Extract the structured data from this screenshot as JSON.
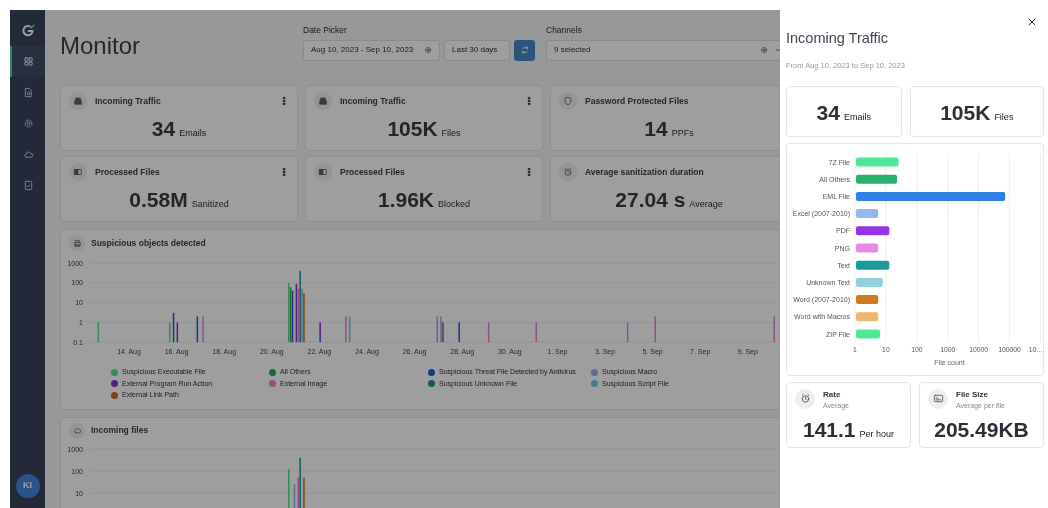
{
  "sidebar": {
    "items": [
      {
        "kind": "dashboard",
        "selected": true
      },
      {
        "kind": "document",
        "selected": false
      },
      {
        "kind": "settings",
        "selected": false
      },
      {
        "kind": "cloud",
        "selected": false
      },
      {
        "kind": "report",
        "selected": false
      }
    ]
  },
  "avatar": {
    "initials": "KI"
  },
  "header": {
    "title": "Monitor",
    "date_picker": {
      "label": "Date Picker",
      "range": "Aug 10, 2023 - Sep 10, 2023",
      "preset": "Last 30 days"
    },
    "channels": {
      "label": "Channels",
      "value": "9 selected"
    }
  },
  "stat_cards": [
    {
      "kind": "inbox",
      "title": "Incoming Traffic",
      "value": "34",
      "unit": "Emails",
      "menu": true
    },
    {
      "kind": "inbox",
      "title": "Incoming Traffic",
      "value": "105K",
      "unit": "Files",
      "menu": true
    },
    {
      "kind": "shield",
      "title": "Password Protected Files",
      "value": "14",
      "unit": "PPFs",
      "menu": false
    },
    {
      "kind": "processed",
      "title": "Processed Files",
      "value": "0.58M",
      "unit": "Sanitized",
      "menu": true
    },
    {
      "kind": "processed",
      "title": "Processed Files",
      "value": "1.96K",
      "unit": "Blocked",
      "menu": true
    },
    {
      "kind": "clock",
      "title": "Average sanitization duration",
      "value": "27.04 s",
      "unit": "Average",
      "menu": false
    }
  ],
  "suspicious_objects": {
    "title": "Suspicious objects detected",
    "y_axis_labels": [
      "1000",
      "100",
      "10",
      "1",
      "0.1"
    ],
    "x_axis_labels": [
      "14. Aug",
      "16. Aug",
      "18. Aug",
      "20. Aug",
      "22. Aug",
      "24. Aug",
      "26. Aug",
      "28. Aug",
      "30. Aug",
      "1. Sep",
      "3. Sep",
      "5. Sep",
      "7. Sep",
      "9. Sep"
    ],
    "legend": [
      {
        "label": "Suspicious Executable File",
        "color": "#358b55"
      },
      {
        "label": "All Others",
        "color": "#176935"
      },
      {
        "label": "Suspicious Threat File Detected by Antivirus",
        "color": "#1b3888"
      },
      {
        "label": "Suspicious Macro",
        "color": "#5d6c91"
      },
      {
        "label": "External Program Run Action",
        "color": "#541e82"
      },
      {
        "label": "External Image",
        "color": "#915188"
      },
      {
        "label": "Suspicious Unknown File",
        "color": "#135b5b"
      },
      {
        "label": "Suspicious Script File",
        "color": "#467d87"
      },
      {
        "label": "External Link Path",
        "color": "#7b4513"
      }
    ]
  },
  "incoming_files": {
    "title": "Incoming files",
    "y_axis_labels": [
      "1000",
      "100",
      "10"
    ]
  },
  "detail_panel": {
    "title": "Incoming Traffic",
    "subtitle": "From Aug 10, 2023 to Sep 10, 2023",
    "stats": [
      {
        "value": "34",
        "unit": "Emails"
      },
      {
        "value": "105K",
        "unit": "Files"
      }
    ],
    "file_chart": {
      "categories": [
        {
          "label": "7Z File",
          "color": "#4ee896"
        },
        {
          "label": "All Others",
          "color": "#27b36f"
        },
        {
          "label": "EML File",
          "color": "#2f80e4"
        },
        {
          "label": "Excel (2007-2010)",
          "color": "#95b6ee"
        },
        {
          "label": "PDF",
          "color": "#9333ea"
        },
        {
          "label": "PNG",
          "color": "#e58ae6"
        },
        {
          "label": "Text",
          "color": "#1b9a9a"
        },
        {
          "label": "Unknown Text",
          "color": "#8fd0dc"
        },
        {
          "label": "Word (2007-2010)",
          "color": "#d17a1e"
        },
        {
          "label": "Word with Macros",
          "color": "#f0b66b"
        },
        {
          "label": "ZIP File",
          "color": "#4ee896"
        }
      ],
      "x_axis_labels": [
        "1",
        "10",
        "100",
        "1000",
        "10000",
        "100000",
        "10…"
      ],
      "x_axis_title": "File count"
    },
    "metrics": [
      {
        "kind": "clock",
        "title": "Rate",
        "subtitle": "Average",
        "value": "141.1",
        "unit": "Per hour"
      },
      {
        "kind": "image",
        "title": "File Size",
        "subtitle": "Average per file",
        "value": "205.49KB"
      }
    ]
  }
}
